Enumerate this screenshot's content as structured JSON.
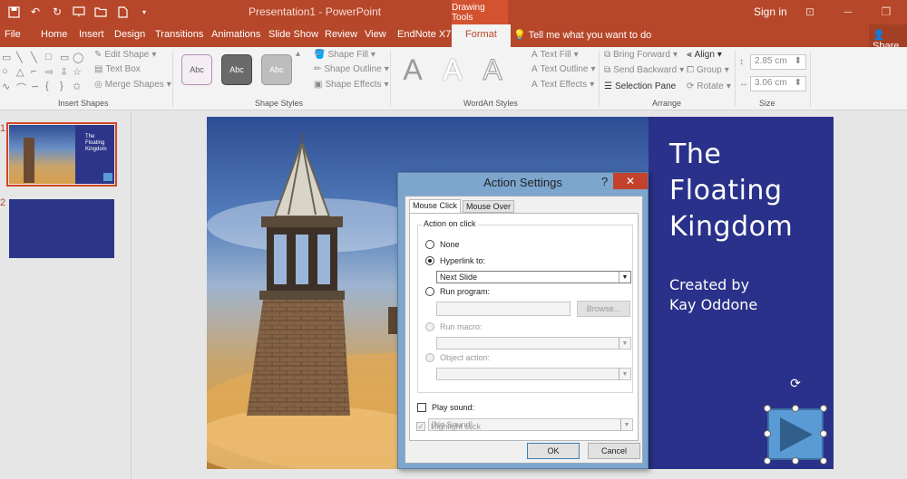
{
  "titlebar": {
    "title": "Presentation1 - PowerPoint",
    "contextual_group": "Drawing Tools",
    "signin": "Sign in"
  },
  "tabs": [
    "File",
    "Home",
    "Insert",
    "Design",
    "Transitions",
    "Animations",
    "Slide Show",
    "Review",
    "View",
    "EndNote X7",
    "Format"
  ],
  "tell_me": "Tell me what you want to do",
  "share": "Share",
  "ribbon": {
    "insert_shapes": {
      "label": "Insert Shapes",
      "edit_shape": "Edit Shape",
      "text_box": "Text Box",
      "merge_shapes": "Merge Shapes"
    },
    "shape_styles": {
      "label": "Shape Styles",
      "swatch_text": "Abc",
      "shape_fill": "Shape Fill",
      "shape_outline": "Shape Outline",
      "shape_effects": "Shape Effects"
    },
    "wordart_styles": {
      "label": "WordArt Styles",
      "letter": "A",
      "text_fill": "Text Fill",
      "text_outline": "Text Outline",
      "text_effects": "Text Effects"
    },
    "arrange": {
      "label": "Arrange",
      "bring_forward": "Bring Forward",
      "send_backward": "Send Backward",
      "selection_pane": "Selection Pane",
      "align": "Align",
      "group": "Group",
      "rotate": "Rotate"
    },
    "size": {
      "label": "Size",
      "height": "2.85 cm",
      "width": "3.06 cm"
    }
  },
  "thumbnails": [
    {
      "number": "1"
    },
    {
      "number": "2"
    }
  ],
  "slide": {
    "title_lines": [
      "The",
      "Floating",
      "Kingdom"
    ],
    "subtitle_lines": [
      "Created by",
      "Kay Oddone"
    ]
  },
  "dialog": {
    "title": "Action Settings",
    "help": "?",
    "close": "✕",
    "tabs": [
      "Mouse Click",
      "Mouse Over"
    ],
    "group_label": "Action on click",
    "options": {
      "none": "None",
      "hyperlink": "Hyperlink to:",
      "run_program": "Run program:",
      "run_macro": "Run macro:",
      "object_action": "Object action:"
    },
    "hyperlink_value": "Next Slide",
    "browse": "Browse...",
    "play_sound": "Play sound:",
    "sound_value": "[No Sound]",
    "highlight_click": "Highlight click",
    "ok": "OK",
    "cancel": "Cancel"
  }
}
